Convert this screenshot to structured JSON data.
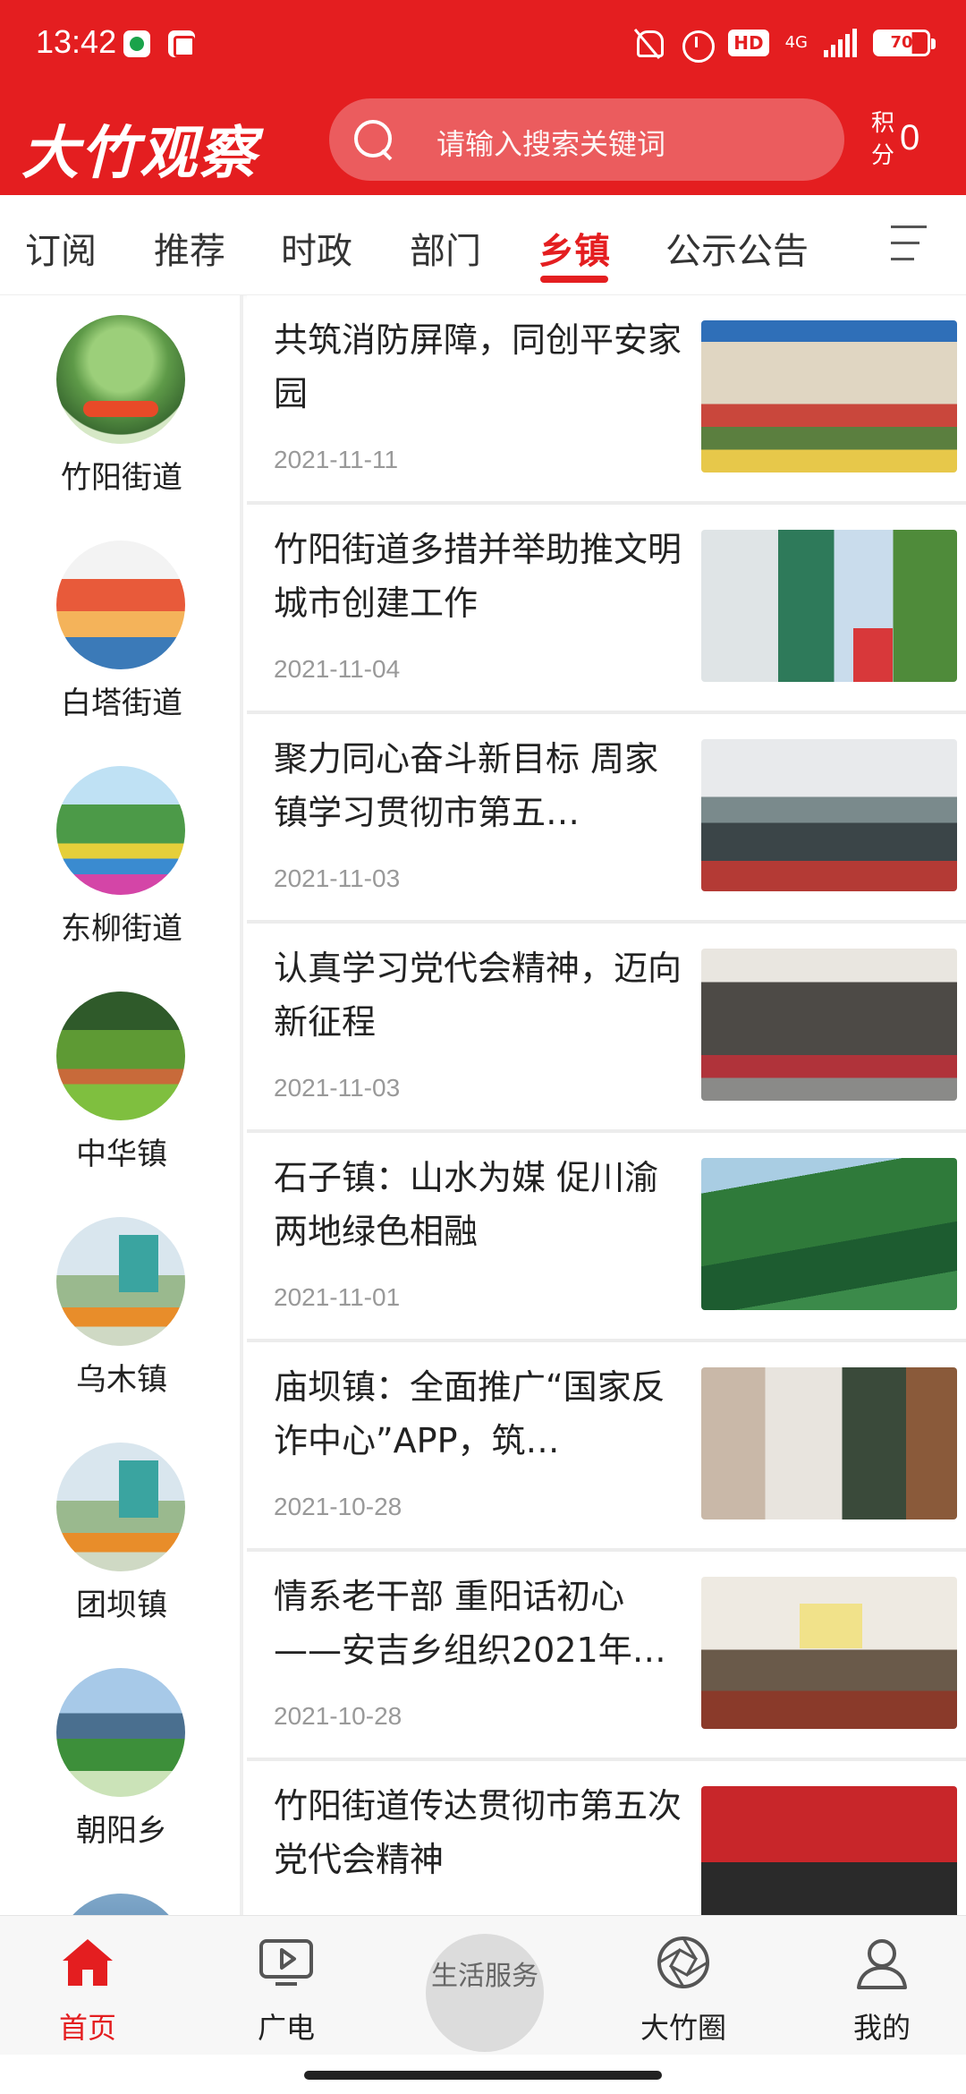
{
  "status_bar": {
    "time": "13:42",
    "hd": "HD",
    "network": "4G",
    "battery": "70"
  },
  "header": {
    "logo": "大竹观察",
    "search_placeholder": "请输入搜索关键词",
    "points_label": "积分",
    "points_value": "0"
  },
  "tabs": [
    {
      "label": "订阅"
    },
    {
      "label": "推荐"
    },
    {
      "label": "时政"
    },
    {
      "label": "部门"
    },
    {
      "label": "乡镇"
    },
    {
      "label": "公示公告"
    }
  ],
  "active_tab": "乡镇",
  "sidebar": {
    "items": [
      {
        "label": "竹阳街道"
      },
      {
        "label": "白塔街道"
      },
      {
        "label": "东柳街道"
      },
      {
        "label": "中华镇"
      },
      {
        "label": "乌木镇"
      },
      {
        "label": "团坝镇"
      },
      {
        "label": "朝阳乡"
      }
    ]
  },
  "news": [
    {
      "title": "共筑消防屏障，同创平安家园",
      "date": "2021-11-11"
    },
    {
      "title": "竹阳街道多措并举助推文明城市创建工作",
      "date": "2021-11-04"
    },
    {
      "title": "聚力同心奋斗新目标 周家镇学习贯彻市第五…",
      "date": "2021-11-03"
    },
    {
      "title": "认真学习党代会精神，迈向新征程",
      "date": "2021-11-03"
    },
    {
      "title": "石子镇：山水为媒 促川渝两地绿色相融",
      "date": "2021-11-01"
    },
    {
      "title": "庙坝镇：全面推广“国家反诈中心”APP，筑…",
      "date": "2021-10-28"
    },
    {
      "title": "情系老干部 重阳话初心——安吉乡组织2021年…",
      "date": "2021-10-28"
    },
    {
      "title": "竹阳街道传达贯彻市第五次党代会精神",
      "date": ""
    }
  ],
  "bottom_nav": {
    "home": "首页",
    "tv": "广电",
    "life_service": "生活服务",
    "circle": "大竹圈",
    "mine": "我的"
  },
  "colors": {
    "brand": "#e41e20",
    "text": "#222222",
    "muted": "#999999"
  }
}
